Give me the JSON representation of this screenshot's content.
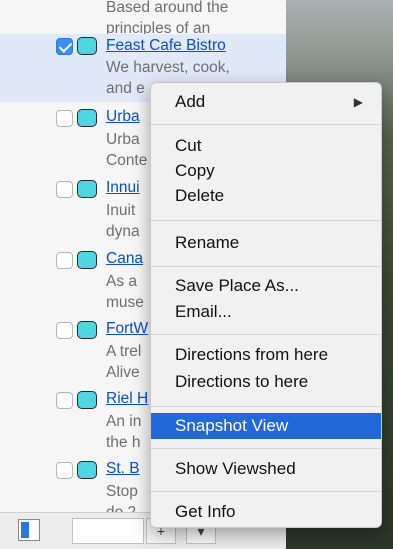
{
  "places": [
    {
      "title": "",
      "desc": [
        "Based around the",
        "principles of an"
      ],
      "checked": false
    },
    {
      "title": "Feast Cafe Bistro",
      "desc": [
        "We harvest, cook,",
        "and e"
      ],
      "checked": true,
      "selected": true
    },
    {
      "title": "Urba",
      "desc": [
        "Urba",
        "Conte"
      ],
      "checked": false
    },
    {
      "title": "Innui",
      "desc": [
        "Inuit",
        "dyna"
      ],
      "checked": false
    },
    {
      "title": "Cana",
      "desc": [
        "As a",
        "muse"
      ],
      "checked": false
    },
    {
      "title": "FortW",
      "desc": [
        "A trel",
        "Alive"
      ],
      "checked": false
    },
    {
      "title": "Riel H",
      "desc": [
        "An in",
        "the h"
      ],
      "checked": false
    },
    {
      "title": "St. B",
      "desc": [
        "Stop",
        "do 2"
      ],
      "checked": false
    }
  ],
  "toolbar": {
    "add_label": "+",
    "options_label": "▾"
  },
  "context_menu": {
    "items": [
      {
        "label": "Add",
        "submenu": true
      },
      {
        "label": "Cut"
      },
      {
        "label": "Copy"
      },
      {
        "label": "Delete"
      },
      {
        "label": "Rename"
      },
      {
        "label": "Save Place As..."
      },
      {
        "label": "Email..."
      },
      {
        "label": "Directions from here"
      },
      {
        "label": "Directions to here"
      },
      {
        "label": "Snapshot View",
        "highlighted": true
      },
      {
        "label": "Show Viewshed"
      },
      {
        "label": "Get Info"
      }
    ],
    "submenu_arrow": "▶"
  },
  "colors": {
    "link": "#0b4ecf",
    "highlight": "#2368d8",
    "pin_fill": "#4fd6e0",
    "checkbox_checked": "#3b8ef2"
  }
}
